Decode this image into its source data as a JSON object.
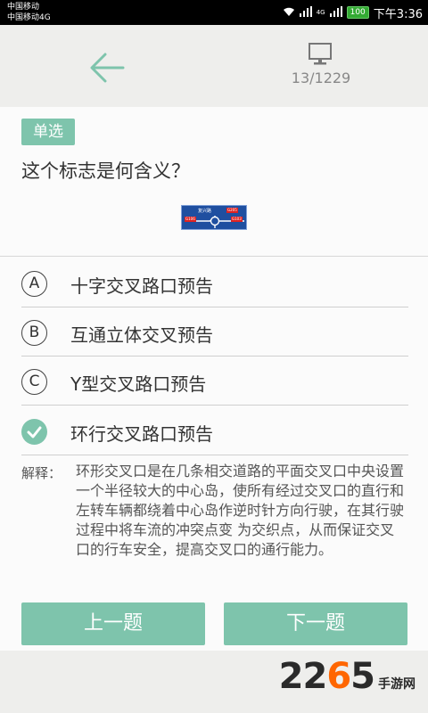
{
  "status_bar": {
    "carrier_1": "中国移动",
    "carrier_2": "中国移动4G",
    "network": "4G",
    "battery": "100",
    "time": "下午3:36"
  },
  "header": {
    "back_icon": "back-arrow-icon",
    "mode_icon": "monitor-icon",
    "progress": "13/1229"
  },
  "question": {
    "type": "单选",
    "text": "这个标志是何含义？",
    "sign": {
      "name": "复兴路",
      "tags": [
        "G205",
        "G106",
        "G103"
      ]
    }
  },
  "options": [
    {
      "letter": "A",
      "text": "十字交叉路口预告",
      "selected": false
    },
    {
      "letter": "B",
      "text": "互通立体交叉预告",
      "selected": false
    },
    {
      "letter": "C",
      "text": "Y型交叉路口预告",
      "selected": false
    },
    {
      "letter": "D",
      "text": "环行交叉路口预告",
      "selected": true
    }
  ],
  "explanation": {
    "label": "解释：",
    "text": "环形交叉口是在几条相交道路的平面交叉口中央设置一个半径较大的中心岛，使所有经过交叉口的直行和左转车辆都绕着中心岛作逆时针方向行驶，在其行驶过程中将车流的冲突点变  为交织点，从而保证交叉口的行车安全，提高交叉口的通行能力。"
  },
  "buttons": {
    "prev": "上一题",
    "next": "下一题"
  },
  "watermark": {
    "num_a": "22",
    "num_o": "6",
    "num_b": "5",
    "site": "手游网"
  },
  "colors": {
    "accent": "#7ec4ac",
    "sign_blue": "#1f4fa0"
  }
}
